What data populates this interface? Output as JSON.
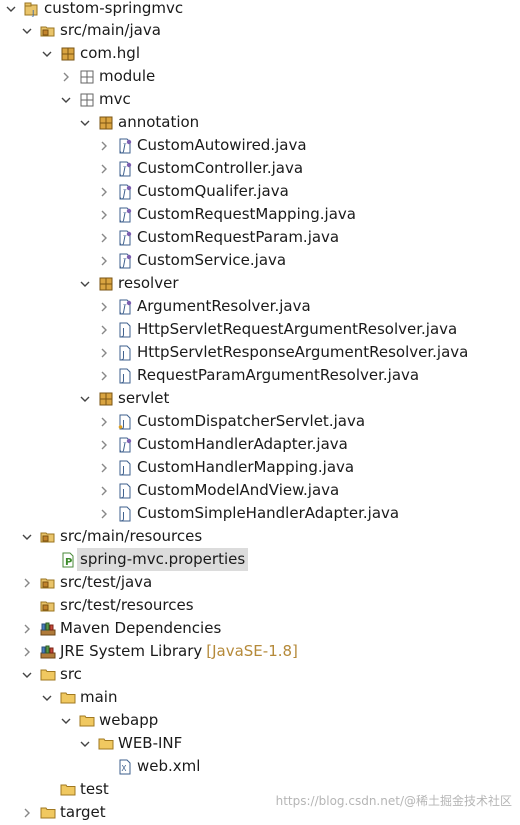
{
  "tree": {
    "rows": [
      {
        "label": "custom-springmvc",
        "twisty": "expanded",
        "icon": "project-icon"
      },
      {
        "label": "src/main/java",
        "twisty": "expanded",
        "icon": "source-folder-icon"
      },
      {
        "label": "com.hgl",
        "twisty": "expanded",
        "icon": "package-icon"
      },
      {
        "label": "module",
        "twisty": "collapsed",
        "icon": "package-empty-icon"
      },
      {
        "label": "mvc",
        "twisty": "expanded",
        "icon": "package-empty-icon"
      },
      {
        "label": "annotation",
        "twisty": "expanded",
        "icon": "package-icon"
      },
      {
        "label": "CustomAutowired.java",
        "twisty": "collapsed",
        "icon": "annotation-file-icon"
      },
      {
        "label": "CustomController.java",
        "twisty": "collapsed",
        "icon": "annotation-file-icon"
      },
      {
        "label": "CustomQualifer.java",
        "twisty": "collapsed",
        "icon": "annotation-file-icon"
      },
      {
        "label": "CustomRequestMapping.java",
        "twisty": "collapsed",
        "icon": "annotation-file-icon"
      },
      {
        "label": "CustomRequestParam.java",
        "twisty": "collapsed",
        "icon": "annotation-file-icon"
      },
      {
        "label": "CustomService.java",
        "twisty": "collapsed",
        "icon": "annotation-file-icon"
      },
      {
        "label": "resolver",
        "twisty": "expanded",
        "icon": "package-icon"
      },
      {
        "label": "ArgumentResolver.java",
        "twisty": "collapsed",
        "icon": "interface-file-icon"
      },
      {
        "label": "HttpServletRequestArgumentResolver.java",
        "twisty": "collapsed",
        "icon": "java-file-icon"
      },
      {
        "label": "HttpServletResponseArgumentResolver.java",
        "twisty": "collapsed",
        "icon": "java-file-icon"
      },
      {
        "label": "RequestParamArgumentResolver.java",
        "twisty": "collapsed",
        "icon": "java-file-icon"
      },
      {
        "label": "servlet",
        "twisty": "expanded",
        "icon": "package-icon"
      },
      {
        "label": "CustomDispatcherServlet.java",
        "twisty": "collapsed",
        "icon": "java-file-icon"
      },
      {
        "label": "CustomHandlerAdapter.java",
        "twisty": "collapsed",
        "icon": "interface-file-icon"
      },
      {
        "label": "CustomHandlerMapping.java",
        "twisty": "collapsed",
        "icon": "java-file-icon"
      },
      {
        "label": "CustomModelAndView.java",
        "twisty": "collapsed",
        "icon": "java-file-icon"
      },
      {
        "label": "CustomSimpleHandlerAdapter.java",
        "twisty": "collapsed",
        "icon": "java-file-icon"
      },
      {
        "label": "src/main/resources",
        "twisty": "expanded",
        "icon": "source-folder-icon"
      },
      {
        "label": "spring-mvc.properties",
        "twisty": "none",
        "icon": "properties-file-icon",
        "selected": true
      },
      {
        "label": "src/test/java",
        "twisty": "collapsed",
        "icon": "source-folder-icon"
      },
      {
        "label": "src/test/resources",
        "twisty": "none",
        "icon": "source-folder-icon"
      },
      {
        "label": "Maven Dependencies",
        "twisty": "collapsed",
        "icon": "library-icon"
      },
      {
        "label": "JRE System Library",
        "decoration": "[JavaSE-1.8]",
        "twisty": "collapsed",
        "icon": "library-icon"
      },
      {
        "label": "src",
        "twisty": "expanded",
        "icon": "folder-icon"
      },
      {
        "label": "main",
        "twisty": "expanded",
        "icon": "folder-icon"
      },
      {
        "label": "webapp",
        "twisty": "expanded",
        "icon": "folder-icon"
      },
      {
        "label": "WEB-INF",
        "twisty": "expanded",
        "icon": "folder-icon"
      },
      {
        "label": "web.xml",
        "twisty": "none",
        "icon": "xml-file-icon"
      },
      {
        "label": "test",
        "twisty": "none",
        "icon": "folder-icon"
      },
      {
        "label": "target",
        "twisty": "collapsed",
        "icon": "folder-icon"
      }
    ]
  },
  "watermark": "https://blog.csdn.net/@稀土掘金技术社区"
}
